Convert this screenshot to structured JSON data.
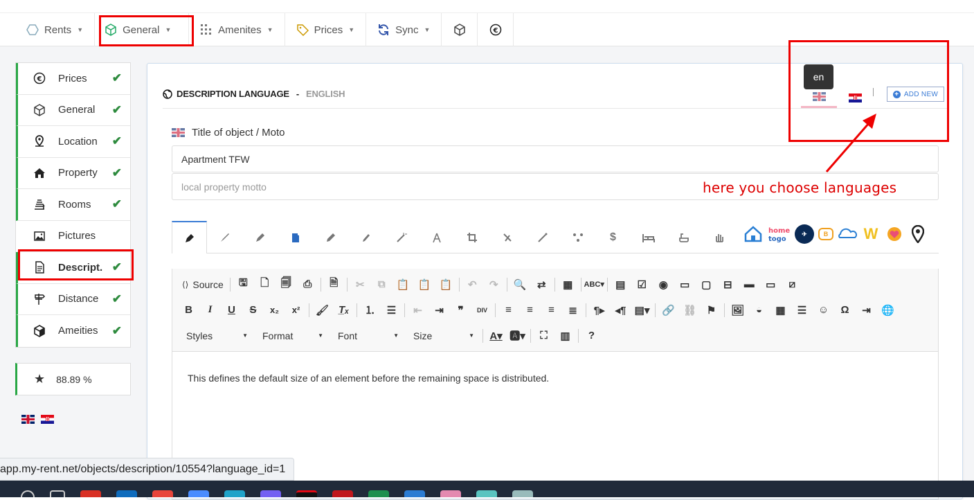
{
  "nav": {
    "items": [
      {
        "label": "Rents",
        "icon": "hexagon-icon"
      },
      {
        "label": "General",
        "icon": "cube-icon"
      },
      {
        "label": "Amenites",
        "icon": "grid-icon"
      },
      {
        "label": "Prices",
        "icon": "tag-icon"
      },
      {
        "label": "Sync",
        "icon": "sync-icon"
      }
    ],
    "extra_icons": [
      "cube-icon",
      "euro-icon"
    ]
  },
  "sidebar": {
    "items": [
      {
        "label": "Prices",
        "icon": "euro-icon",
        "checked": true
      },
      {
        "label": "General",
        "icon": "cube-icon",
        "checked": true
      },
      {
        "label": "Location",
        "icon": "pin-icon",
        "checked": true
      },
      {
        "label": "Property",
        "icon": "home-icon",
        "checked": true
      },
      {
        "label": "Rooms",
        "icon": "bed-icon",
        "checked": true
      },
      {
        "label": "Pictures",
        "icon": "image-icon",
        "checked": false
      },
      {
        "label": "Descript.",
        "icon": "document-icon",
        "checked": true
      },
      {
        "label": "Distance",
        "icon": "signpost-icon",
        "checked": true
      },
      {
        "label": "Ameities",
        "icon": "box-icon",
        "checked": true
      }
    ],
    "score": "88.89 %"
  },
  "description": {
    "heading": "DESCRIPTION LANGUAGE",
    "separator": "-",
    "language": "ENGLISH",
    "tooltip": "en",
    "add_new": "ADD NEW",
    "title_label": "Title of object / Moto",
    "title_value": "Apartment TFW",
    "motto_placeholder": "local property motto",
    "annotation": "here you choose languages"
  },
  "editor": {
    "source_label": "Source",
    "combos": [
      "Styles",
      "Format",
      "Font",
      "Size"
    ],
    "content": "This defines the default size of an element before the remaining space is distributed."
  },
  "status": {
    "url": "app.my-rent.net/objects/description/10554?language_id=1"
  },
  "colors": {
    "accent_green": "#28a745",
    "highlight_red": "#e00000",
    "link_blue": "#3a7bd5"
  }
}
